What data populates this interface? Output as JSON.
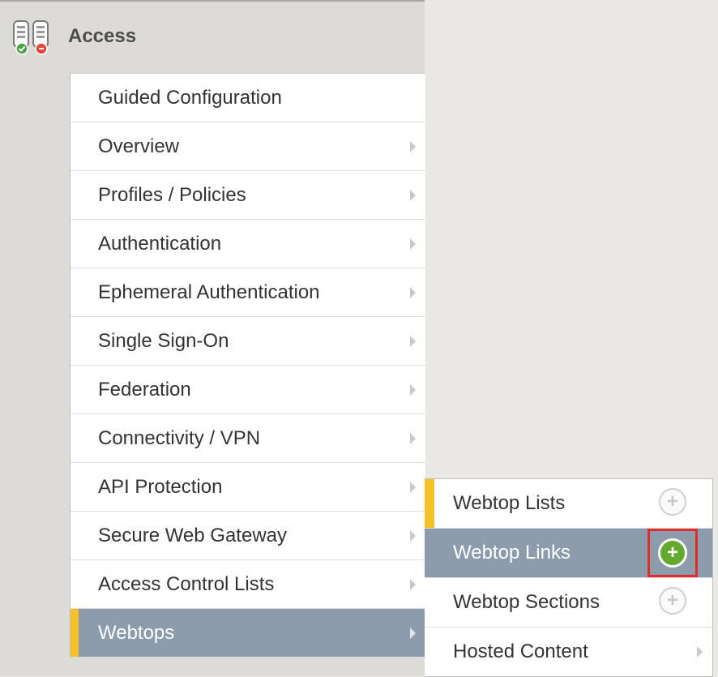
{
  "header": {
    "title": "Access",
    "icon": "access-policy-icon"
  },
  "menu": {
    "items": [
      {
        "label": "Guided Configuration",
        "has_submenu": false
      },
      {
        "label": "Overview",
        "has_submenu": true
      },
      {
        "label": "Profiles / Policies",
        "has_submenu": true
      },
      {
        "label": "Authentication",
        "has_submenu": true
      },
      {
        "label": "Ephemeral Authentication",
        "has_submenu": true
      },
      {
        "label": "Single Sign-On",
        "has_submenu": true
      },
      {
        "label": "Federation",
        "has_submenu": true
      },
      {
        "label": "Connectivity / VPN",
        "has_submenu": true
      },
      {
        "label": "API Protection",
        "has_submenu": true
      },
      {
        "label": "Secure Web Gateway",
        "has_submenu": true
      },
      {
        "label": "Access Control Lists",
        "has_submenu": true
      },
      {
        "label": "Webtops",
        "has_submenu": true,
        "selected": true
      }
    ]
  },
  "submenu": {
    "items": [
      {
        "label": "Webtop Lists",
        "action": "add"
      },
      {
        "label": "Webtop Links",
        "action": "add",
        "highlighted": true
      },
      {
        "label": "Webtop Sections",
        "action": "add"
      },
      {
        "label": "Hosted Content",
        "action": "submenu"
      }
    ]
  },
  "colors": {
    "selected_bg": "#8d9cad",
    "accent": "#f5c226",
    "add_active": "#62a92e",
    "highlight_box": "#e12d2a"
  }
}
